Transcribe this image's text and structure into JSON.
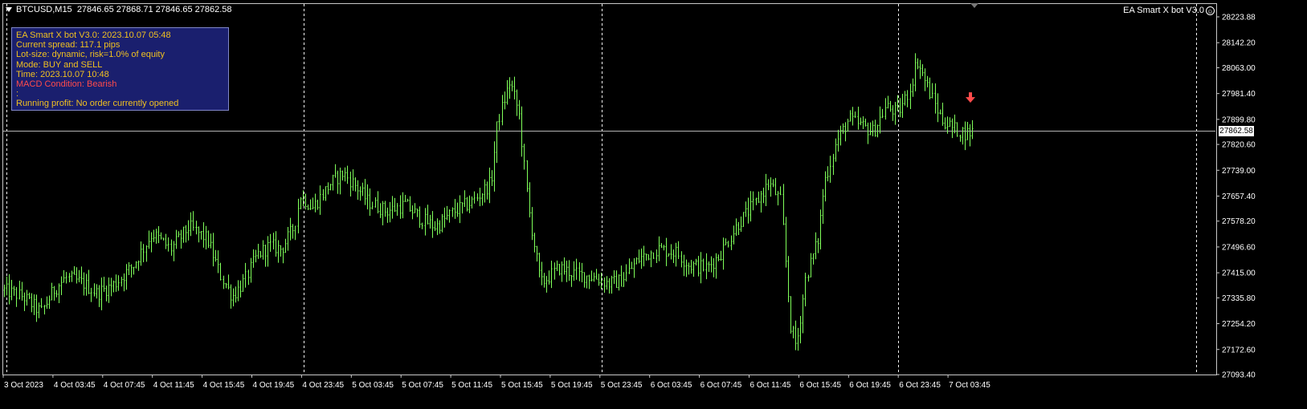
{
  "header": {
    "symbol": "BTCUSD,M15",
    "ohlc": "27846.65 27868.71 27846.65 27862.58"
  },
  "ea_name": "EA Smart X bot V3.0",
  "smiley_icon": "smiley-face-icon",
  "info_panel": {
    "line1": "EA Smart X bot V3.0: 2023.10.07 05:48",
    "line2": "Current spread: 117.1 pips",
    "line3": "Lot-size: dynamic, risk=1.0% of equity",
    "line4": "Mode: BUY and SELL",
    "line5": "Time: 2023.10.07 10:48",
    "line6": "MACD Condition: Bearish",
    "line7": ":",
    "line8": "Running profit: No order currently opened"
  },
  "current_price": "27862.58",
  "colors": {
    "background": "#000000",
    "candle": "#7fff5a",
    "grid": "#ffffff",
    "panel_bg": "#1a1f6e",
    "panel_text": "#f0c020",
    "bearish": "#ff4b4b"
  },
  "chart_data": {
    "type": "candlestick",
    "symbol": "BTCUSD",
    "timeframe": "M15",
    "y_ticks": [
      "28223.88",
      "28142.20",
      "28063.00",
      "27981.40",
      "27899.80",
      "27820.60",
      "27739.00",
      "27657.40",
      "27578.20",
      "27496.60",
      "27415.00",
      "27335.80",
      "27254.20",
      "27172.60",
      "27093.40"
    ],
    "ylim": [
      27080,
      28250
    ],
    "x_ticks": [
      "3 Oct 2023",
      "4 Oct 03:45",
      "4 Oct 07:45",
      "4 Oct 11:45",
      "4 Oct 15:45",
      "4 Oct 19:45",
      "4 Oct 23:45",
      "5 Oct 03:45",
      "5 Oct 07:45",
      "5 Oct 11:45",
      "5 Oct 15:45",
      "5 Oct 19:45",
      "5 Oct 23:45",
      "6 Oct 03:45",
      "6 Oct 07:45",
      "6 Oct 11:45",
      "6 Oct 15:45",
      "6 Oct 19:45",
      "6 Oct 23:45",
      "7 Oct 03:45"
    ],
    "day_separators": [
      "3 Oct 2023",
      "4 Oct 23:45",
      "5 Oct 23:45",
      "6 Oct 23:45"
    ],
    "current_price": 27862.58,
    "signal": {
      "type": "sell-arrow",
      "time": "7 Oct 02:15",
      "price": 27955
    },
    "price_path": [
      [
        0,
        27360
      ],
      [
        6,
        27340
      ],
      [
        12,
        27290
      ],
      [
        16,
        27360
      ],
      [
        20,
        27400
      ],
      [
        26,
        27380
      ],
      [
        30,
        27350
      ],
      [
        36,
        27380
      ],
      [
        42,
        27440
      ],
      [
        48,
        27540
      ],
      [
        54,
        27490
      ],
      [
        60,
        27560
      ],
      [
        66,
        27520
      ],
      [
        70,
        27410
      ],
      [
        74,
        27340
      ],
      [
        78,
        27390
      ],
      [
        82,
        27470
      ],
      [
        86,
        27500
      ],
      [
        90,
        27490
      ],
      [
        94,
        27560
      ],
      [
        96,
        27660
      ],
      [
        100,
        27620
      ],
      [
        106,
        27700
      ],
      [
        110,
        27730
      ],
      [
        114,
        27690
      ],
      [
        118,
        27640
      ],
      [
        124,
        27610
      ],
      [
        130,
        27630
      ],
      [
        136,
        27580
      ],
      [
        140,
        27560
      ],
      [
        146,
        27610
      ],
      [
        152,
        27640
      ],
      [
        158,
        27700
      ],
      [
        160,
        27890
      ],
      [
        164,
        28020
      ],
      [
        167,
        27920
      ],
      [
        170,
        27620
      ],
      [
        174,
        27380
      ],
      [
        180,
        27430
      ],
      [
        186,
        27410
      ],
      [
        192,
        27400
      ],
      [
        196,
        27380
      ],
      [
        200,
        27390
      ],
      [
        206,
        27460
      ],
      [
        212,
        27490
      ],
      [
        218,
        27480
      ],
      [
        222,
        27440
      ],
      [
        228,
        27430
      ],
      [
        232,
        27470
      ],
      [
        238,
        27570
      ],
      [
        244,
        27640
      ],
      [
        248,
        27700
      ],
      [
        252,
        27640
      ],
      [
        255,
        27250
      ],
      [
        257,
        27180
      ],
      [
        260,
        27400
      ],
      [
        264,
        27520
      ],
      [
        266,
        27700
      ],
      [
        270,
        27830
      ],
      [
        274,
        27900
      ],
      [
        278,
        27880
      ],
      [
        282,
        27860
      ],
      [
        286,
        27940
      ],
      [
        290,
        27920
      ],
      [
        294,
        28000
      ],
      [
        296,
        28090
      ],
      [
        300,
        27990
      ],
      [
        304,
        27900
      ],
      [
        308,
        27870
      ],
      [
        312,
        27855
      ],
      [
        314,
        27862
      ]
    ]
  }
}
